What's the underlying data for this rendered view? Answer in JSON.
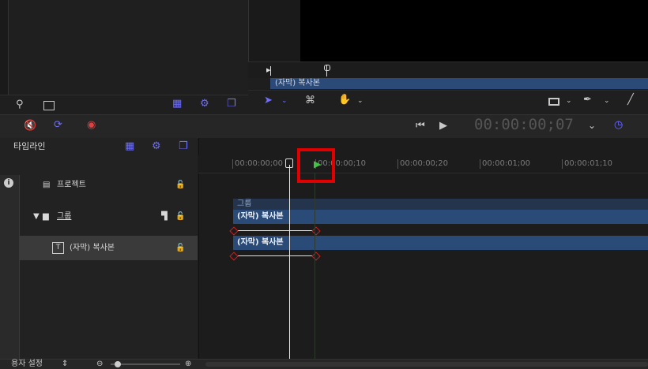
{
  "mini_timeline": {
    "clip_label": "(자막) 복사본"
  },
  "toolbar": {
    "timecode": "00:00:00;07"
  },
  "timeline": {
    "header_title": "타임라인",
    "ruler_labels": [
      "00:00:00;00",
      "00:00:00;10",
      "00:00:00;20",
      "00:00:01;00",
      "00:00:01;10"
    ],
    "layers": [
      {
        "label": "프로젝트"
      },
      {
        "label": "그룹"
      },
      {
        "label": "(자막) 복사본"
      }
    ],
    "group_bar_label": "그룹",
    "clip_bars": [
      "(자막) 복사본",
      "(자막) 복사본"
    ]
  },
  "bottom": {
    "setting_label": "용자 설정"
  }
}
